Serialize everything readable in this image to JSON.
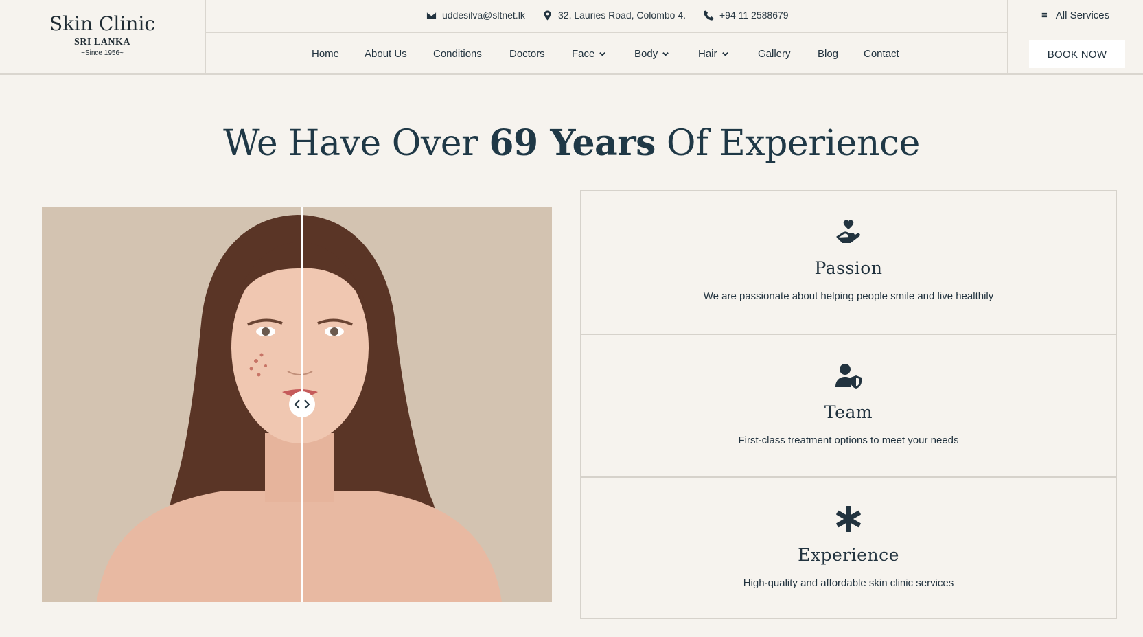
{
  "logo": {
    "title": "Skin Clinic",
    "subtitle": "SRI LANKA",
    "since": "~Since 1956~"
  },
  "contact": {
    "email": "uddesilva@sltnet.lk",
    "address": "32, Lauries Road, Colombo 4.",
    "phone": "+94 11 2588679"
  },
  "nav": {
    "home": "Home",
    "about": "About Us",
    "conditions": "Conditions",
    "doctors": "Doctors",
    "face": "Face",
    "body": "Body",
    "hair": "Hair",
    "gallery": "Gallery",
    "blog": "Blog",
    "contact": "Contact"
  },
  "header_right": {
    "all_services": "All Services",
    "book_now": "BOOK NOW"
  },
  "hero": {
    "prefix": "We Have Over ",
    "highlight": "69 Years",
    "suffix": " Of Experience"
  },
  "features": [
    {
      "icon": "hand-heart-icon",
      "title": "Passion",
      "desc": "We are passionate about helping people smile and live healthily"
    },
    {
      "icon": "user-shield-icon",
      "title": "Team",
      "desc": "First-class treatment options to meet your needs"
    },
    {
      "icon": "asterisk-icon",
      "title": "Experience",
      "desc": "High-quality and affordable skin clinic services"
    }
  ],
  "colors": {
    "background": "#f6f3ee",
    "text": "#22333f",
    "accent": "#1f3846",
    "image_bg": "#d3c3b1"
  }
}
